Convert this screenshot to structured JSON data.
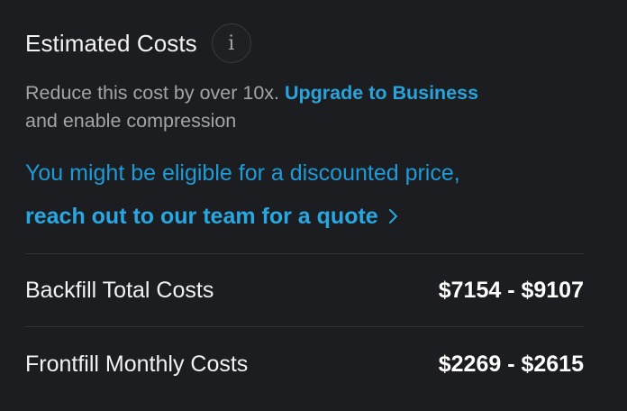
{
  "header": {
    "title": "Estimated Costs",
    "info_icon": "info-icon",
    "info_glyph": "i"
  },
  "reduce": {
    "text_before": "Reduce this cost by over 10x.",
    "link": "Upgrade to Business",
    "text_after": "and enable compression"
  },
  "discount": {
    "line1": "You might be eligible for a discounted price,",
    "link": "reach out to our team for a quote",
    "link_icon": "chevron-right-icon"
  },
  "costs": [
    {
      "label": "Backfill Total Costs",
      "value": "$7154 - $9107"
    },
    {
      "label": "Frontfill Monthly Costs",
      "value": "$2269 - $2615"
    }
  ],
  "colors": {
    "background": "#1c1d20",
    "accent": "#1e9bd7",
    "muted_text": "#a3a4a7",
    "divider": "#2f3034"
  }
}
